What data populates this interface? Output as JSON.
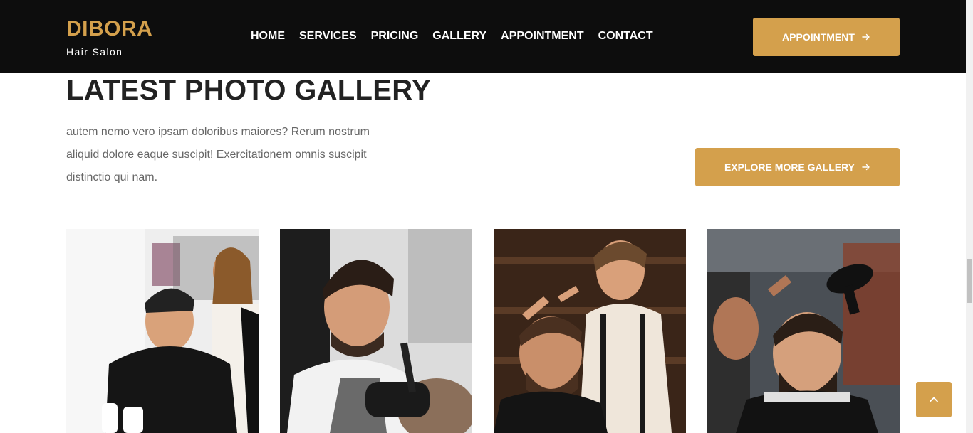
{
  "brand": {
    "name": "DIBORA",
    "tagline": "Hair Salon"
  },
  "nav": {
    "items": [
      {
        "label": "HOME"
      },
      {
        "label": "SERVICES"
      },
      {
        "label": "PRICING"
      },
      {
        "label": "GALLERY"
      },
      {
        "label": "APPOINTMENT"
      },
      {
        "label": "CONTACT"
      }
    ],
    "cta_label": "APPOINTMENT"
  },
  "gallery": {
    "title": "LATEST PHOTO GALLERY",
    "description": "autem nemo vero ipsam doloribus maiores? Rerum nostrum aliquid dolore eaque suscipit! Exercitationem omnis suscipit distinctio qui nam.",
    "explore_label": "EXPLORE MORE GALLERY",
    "images": [
      {
        "icon": "photo-client-with-stylist"
      },
      {
        "icon": "photo-barber-trimming"
      },
      {
        "icon": "photo-barber-scissors"
      },
      {
        "icon": "photo-barber-blowdryer"
      }
    ]
  },
  "colors": {
    "accent": "#d4a04c",
    "header_bg": "#0d0d0d",
    "title": "#222222",
    "body_text": "#666666"
  }
}
